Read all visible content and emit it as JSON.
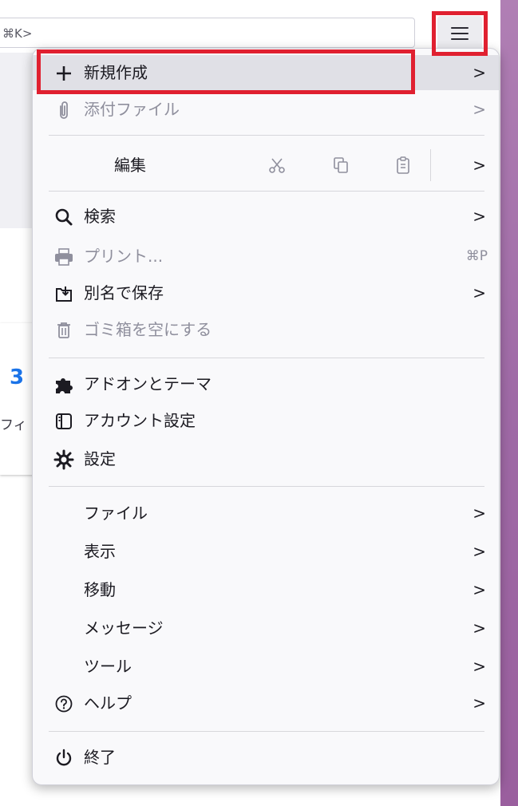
{
  "toolbar": {
    "search_hint": "⌘K>",
    "menu_button_label": "≡"
  },
  "background": {
    "partial_label": "フィ",
    "partial_glyph": "3"
  },
  "menu": {
    "new_label": "新規作成",
    "attach_label": "添付ファイル",
    "edit": {
      "label": "編集",
      "cut_icon": "scissors-icon",
      "copy_icon": "copy-icon",
      "paste_icon": "paste-icon"
    },
    "find_label": "検索",
    "print_label": "プリント...",
    "print_shortcut": "⌘P",
    "save_as_label": "別名で保存",
    "empty_trash_label": "ゴミ箱を空にする",
    "addons_label": "アドオンとテーマ",
    "account_label": "アカウント設定",
    "settings_label": "設定",
    "file_label": "ファイル",
    "view_label": "表示",
    "go_label": "移動",
    "message_label": "メッセージ",
    "tools_label": "ツール",
    "help_label": "ヘルプ",
    "quit_label": "終了",
    "chevron": ">"
  },
  "colors": {
    "highlight_box": "#e02030",
    "accent_strip": "#a46aa8",
    "hover_bg": "#e0e0e6"
  }
}
